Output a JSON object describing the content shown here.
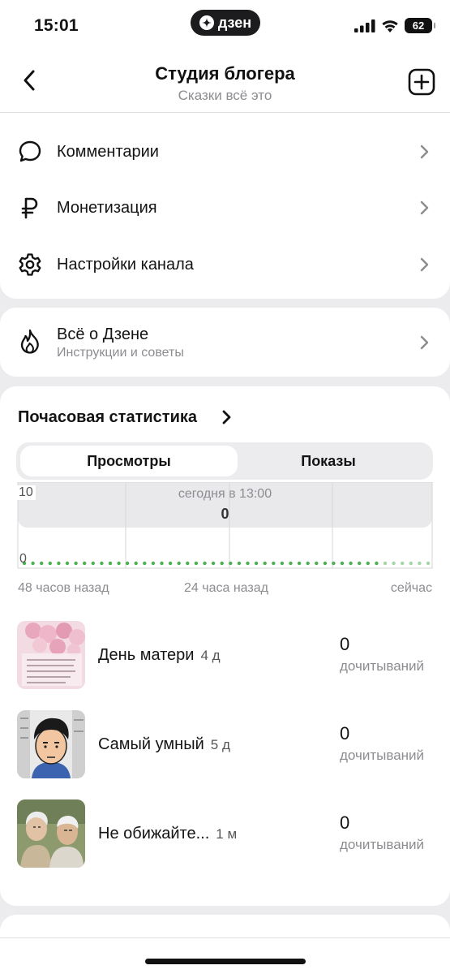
{
  "status_bar": {
    "time": "15:01",
    "app_pill": "дзен",
    "battery": "62"
  },
  "header": {
    "title": "Студия блогера",
    "subtitle": "Сказки всё это"
  },
  "menu": {
    "items": [
      {
        "label": "Комментарии",
        "icon": "comment-icon"
      },
      {
        "label": "Монетизация",
        "icon": "ruble-icon"
      },
      {
        "label": "Настройки канала",
        "icon": "gear-icon"
      }
    ]
  },
  "about": {
    "title": "Всё о Дзене",
    "subtitle": "Инструкции и советы",
    "icon": "flame-icon"
  },
  "stats": {
    "title": "Почасовая статистика",
    "tabs": [
      {
        "label": "Просмотры",
        "active": true
      },
      {
        "label": "Показы",
        "active": false
      }
    ],
    "chart_data": {
      "type": "line",
      "title": "",
      "ylim": [
        0,
        10
      ],
      "y_ticks": [
        "10",
        "0"
      ],
      "x_labels": [
        "48 часов назад",
        "24 часа назад",
        "сейчас"
      ],
      "tooltip_date": "сегодня в 13:00",
      "tooltip_value": "0",
      "series": [
        {
          "values": [
            0,
            0,
            0,
            0,
            0,
            0,
            0,
            0,
            0,
            0,
            0,
            0,
            0,
            0,
            0,
            0,
            0,
            0,
            0,
            0,
            0,
            0,
            0,
            0,
            0,
            0,
            0,
            0,
            0,
            0,
            0,
            0,
            0,
            0,
            0,
            0,
            0,
            0,
            0,
            0,
            0,
            0,
            0,
            0,
            0,
            0,
            0,
            0
          ]
        }
      ],
      "colors": {
        "line": "#4caf50",
        "line_recent": "#a5d6a7"
      }
    }
  },
  "articles": [
    {
      "title": "День матери",
      "age": "4 д",
      "count": "0",
      "caption": "дочитываний"
    },
    {
      "title": "Самый умный",
      "age": "5 д",
      "count": "0",
      "caption": "дочитываний"
    },
    {
      "title": "Не обижайте...",
      "age": "1 м",
      "count": "0",
      "caption": "дочитываний"
    }
  ]
}
